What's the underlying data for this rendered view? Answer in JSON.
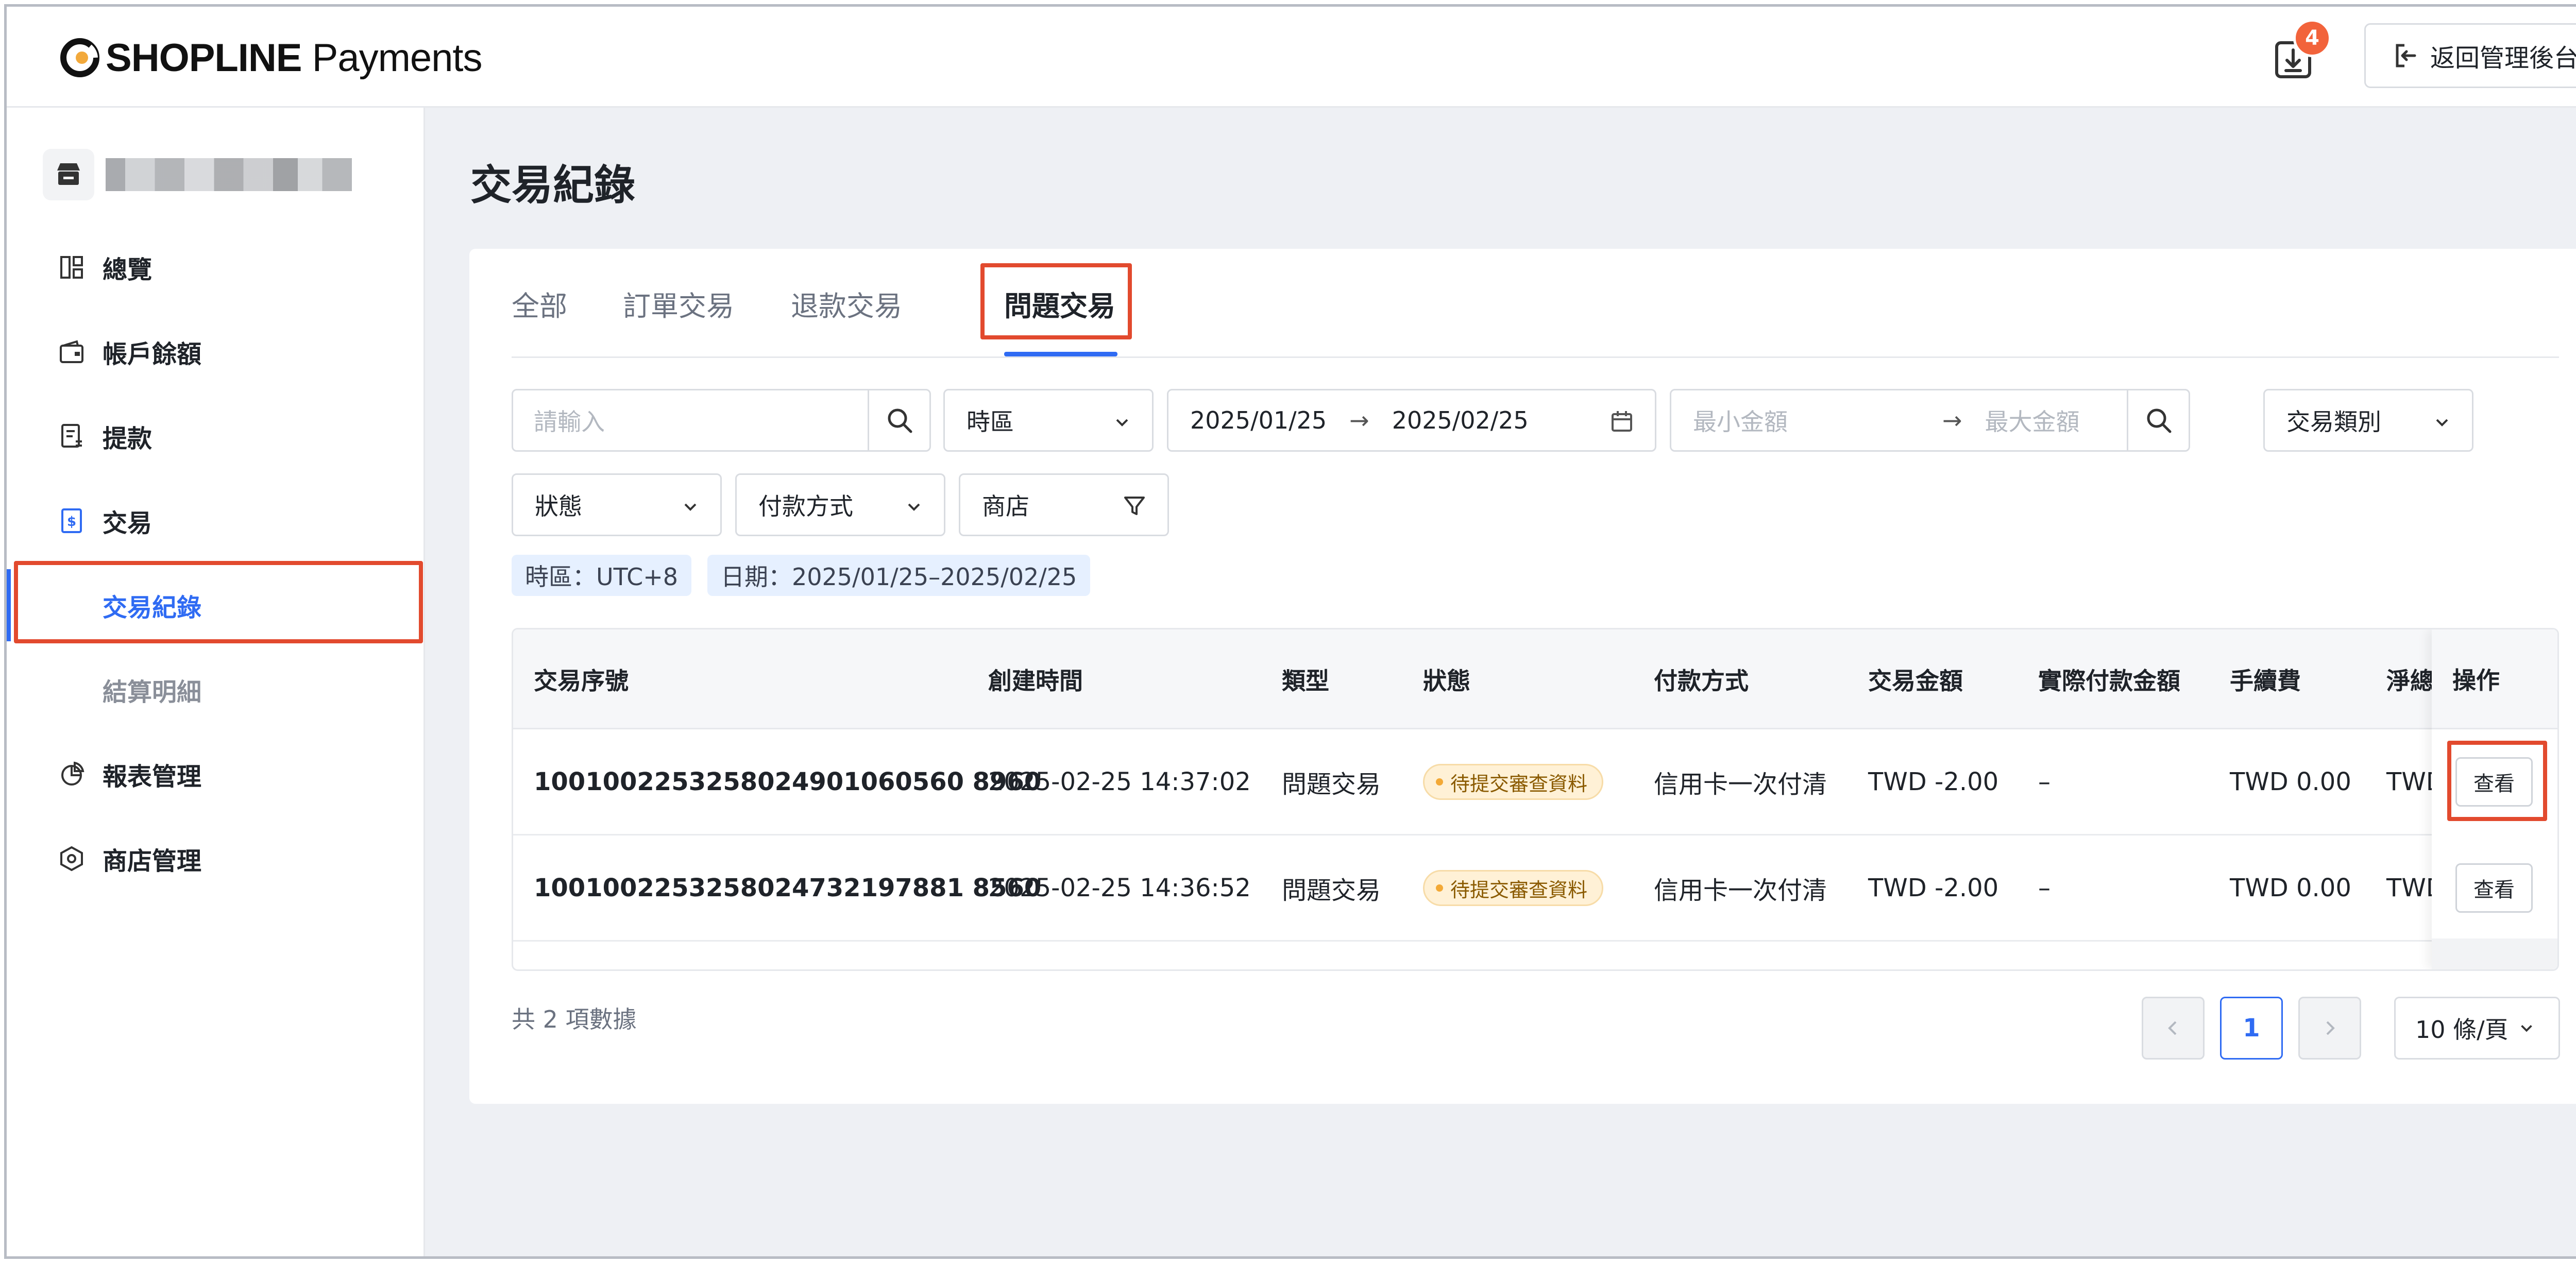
{
  "header": {
    "brand_bold": "SHOPLINE",
    "brand_light": "Payments",
    "download_badge": "4",
    "back_button": "返回管理後台"
  },
  "sidebar": {
    "items": [
      {
        "label": "總覽",
        "icon": "dashboard-icon"
      },
      {
        "label": "帳戶餘額",
        "icon": "wallet-icon"
      },
      {
        "label": "提款",
        "icon": "withdraw-icon"
      },
      {
        "label": "交易",
        "icon": "dollar-doc-icon"
      },
      {
        "label": "交易紀錄",
        "sub": true,
        "active": true
      },
      {
        "label": "結算明細",
        "sub": true
      },
      {
        "label": "報表管理",
        "icon": "pie-chart-icon"
      },
      {
        "label": "商店管理",
        "icon": "store-settings-icon"
      }
    ]
  },
  "main": {
    "title": "交易紀錄",
    "tabs": [
      "全部",
      "訂單交易",
      "退款交易",
      "問題交易"
    ],
    "active_tab": "問題交易",
    "filters": {
      "search_placeholder": "請輸入",
      "timezone_label": "時區",
      "date_start": "2025/01/25",
      "date_end": "2025/02/25",
      "min_amount_placeholder": "最小金額",
      "max_amount_placeholder": "最大金額",
      "transaction_type_label": "交易類別",
      "status_label": "狀態",
      "payment_method_label": "付款方式",
      "store_label": "商店"
    },
    "tags": [
      "時區：UTC+8",
      "日期：2025/01/25–2025/02/25"
    ],
    "table": {
      "columns": [
        "交易序號",
        "創建時間",
        "類型",
        "狀態",
        "付款方式",
        "交易金額",
        "實際付款金額",
        "手續費",
        "淨總",
        "操作"
      ],
      "rows": [
        {
          "id": "1001002253258024901060560 8960",
          "created": "2025-02-25 14:37:02",
          "type": "問題交易",
          "status": "待提交審查資料",
          "method": "信用卡一次付清",
          "amount": "TWD -2.00",
          "actual": "–",
          "fee": "TWD 0.00",
          "net": "TWD",
          "action": "查看"
        },
        {
          "id": "1001002253258024732197881 8560",
          "created": "2025-02-25 14:36:52",
          "type": "問題交易",
          "status": "待提交審查資料",
          "method": "信用卡一次付清",
          "amount": "TWD -2.00",
          "actual": "–",
          "fee": "TWD 0.00",
          "net": "TWD",
          "action": "查看"
        }
      ]
    },
    "pagination": {
      "total_text": "共 2 項數據",
      "current_page": "1",
      "page_size": "10 條/頁"
    }
  },
  "colors": {
    "accent": "#2f6bf3",
    "highlight_box": "#e24a2e",
    "badge": "#f2633b",
    "status_pending_bg": "#fff1d6"
  }
}
